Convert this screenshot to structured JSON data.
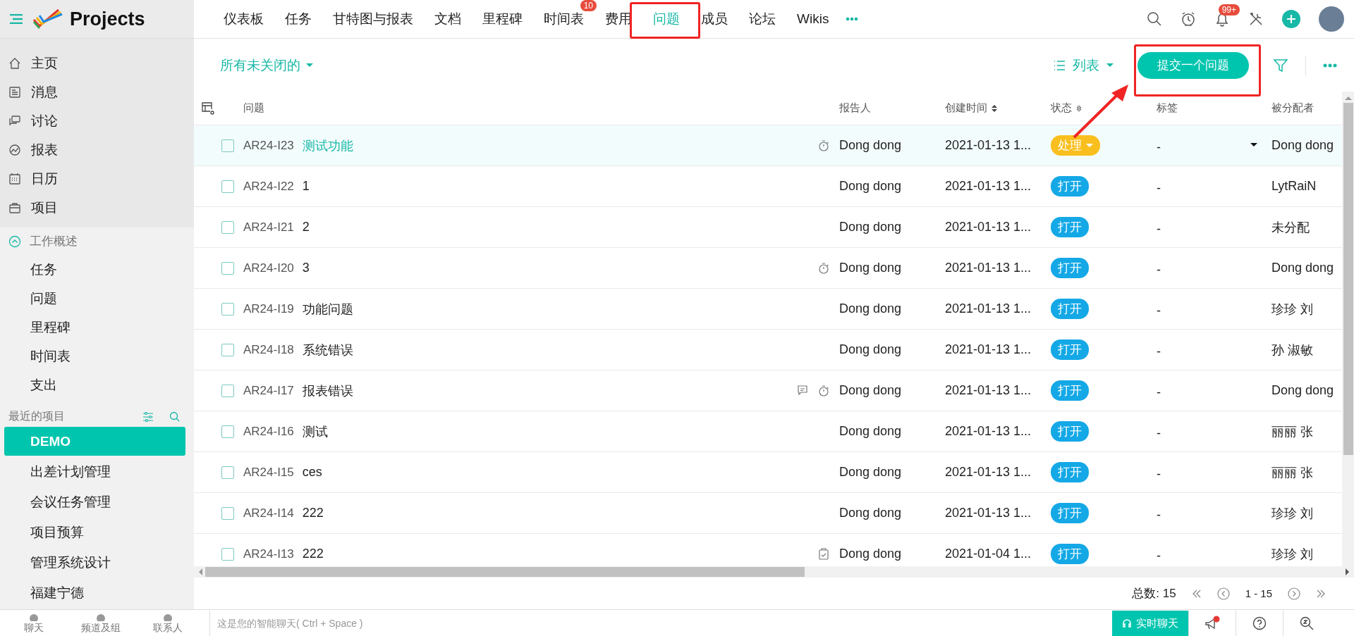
{
  "app": {
    "name": "Projects"
  },
  "sidebar": {
    "items": [
      "主页",
      "消息",
      "讨论",
      "报表",
      "日历",
      "项目"
    ],
    "overview": {
      "title": "工作概述",
      "expanded": true,
      "items": [
        "任务",
        "问题",
        "里程碑",
        "时间表",
        "支出"
      ]
    },
    "recent": {
      "title": "最近的项目",
      "projects": [
        {
          "label": "DEMO",
          "selected": true
        },
        {
          "label": "出差计划管理",
          "selected": false
        },
        {
          "label": "会议任务管理",
          "selected": false
        },
        {
          "label": "项目预算",
          "selected": false
        },
        {
          "label": "管理系统设计",
          "selected": false
        },
        {
          "label": "福建宁德",
          "selected": false
        }
      ]
    }
  },
  "tabs": [
    {
      "label": "仪表板",
      "selected": false
    },
    {
      "label": "任务",
      "selected": false
    },
    {
      "label": "甘特图与报表",
      "selected": false
    },
    {
      "label": "文档",
      "selected": false
    },
    {
      "label": "里程碑",
      "selected": false
    },
    {
      "label": "时间表",
      "selected": false,
      "badge": "10"
    },
    {
      "label": "费用",
      "selected": false
    },
    {
      "label": "问题",
      "selected": true
    },
    {
      "label": "成员",
      "selected": false
    },
    {
      "label": "论坛",
      "selected": false
    },
    {
      "label": "Wikis",
      "selected": false
    }
  ],
  "notifications_badge": "99+",
  "toolbar": {
    "filter_view": "所有未关闭的",
    "layout": "列表",
    "submit_button": "提交一个问题"
  },
  "table": {
    "columns": [
      "问题",
      "报告人",
      "创建时间",
      "状态",
      "标签",
      "被分配者"
    ],
    "rows": [
      {
        "id": "AR24-I23",
        "title": "测试功能",
        "selected": true,
        "comment": false,
        "timer": true,
        "checklist": false,
        "reporter": "Dong dong",
        "created": "2021-01-13 1...",
        "status": {
          "label": "处理",
          "color": "#f9bf1e",
          "dropdown": true
        },
        "tag": "-",
        "assignee": "Dong dong"
      },
      {
        "id": "AR24-I22",
        "title": "1",
        "selected": false,
        "comment": false,
        "timer": false,
        "checklist": false,
        "reporter": "Dong dong",
        "created": "2021-01-13 1...",
        "status": {
          "label": "打开",
          "color": "#14a8e6",
          "dropdown": false
        },
        "tag": "-",
        "assignee": "LytRaiN"
      },
      {
        "id": "AR24-I21",
        "title": "2",
        "selected": false,
        "comment": false,
        "timer": false,
        "checklist": false,
        "reporter": "Dong dong",
        "created": "2021-01-13 1...",
        "status": {
          "label": "打开",
          "color": "#14a8e6",
          "dropdown": false
        },
        "tag": "-",
        "assignee": "未分配"
      },
      {
        "id": "AR24-I20",
        "title": "3",
        "selected": false,
        "comment": false,
        "timer": true,
        "checklist": false,
        "reporter": "Dong dong",
        "created": "2021-01-13 1...",
        "status": {
          "label": "打开",
          "color": "#14a8e6",
          "dropdown": false
        },
        "tag": "-",
        "assignee": "Dong dong"
      },
      {
        "id": "AR24-I19",
        "title": "功能问题",
        "selected": false,
        "comment": false,
        "timer": false,
        "checklist": false,
        "reporter": "Dong dong",
        "created": "2021-01-13 1...",
        "status": {
          "label": "打开",
          "color": "#14a8e6",
          "dropdown": false
        },
        "tag": "-",
        "assignee": "珍珍 刘"
      },
      {
        "id": "AR24-I18",
        "title": "系统错误",
        "selected": false,
        "comment": false,
        "timer": false,
        "checklist": false,
        "reporter": "Dong dong",
        "created": "2021-01-13 1...",
        "status": {
          "label": "打开",
          "color": "#14a8e6",
          "dropdown": false
        },
        "tag": "-",
        "assignee": "孙 淑敏"
      },
      {
        "id": "AR24-I17",
        "title": "报表错误",
        "selected": false,
        "comment": true,
        "timer": true,
        "checklist": false,
        "reporter": "Dong dong",
        "created": "2021-01-13 1...",
        "status": {
          "label": "打开",
          "color": "#14a8e6",
          "dropdown": false
        },
        "tag": "-",
        "assignee": "Dong dong"
      },
      {
        "id": "AR24-I16",
        "title": "测试",
        "selected": false,
        "comment": false,
        "timer": false,
        "checklist": false,
        "reporter": "Dong dong",
        "created": "2021-01-13 1...",
        "status": {
          "label": "打开",
          "color": "#14a8e6",
          "dropdown": false
        },
        "tag": "-",
        "assignee": "丽丽 张"
      },
      {
        "id": "AR24-I15",
        "title": "ces",
        "selected": false,
        "comment": false,
        "timer": false,
        "checklist": false,
        "reporter": "Dong dong",
        "created": "2021-01-13 1...",
        "status": {
          "label": "打开",
          "color": "#14a8e6",
          "dropdown": false
        },
        "tag": "-",
        "assignee": "丽丽 张"
      },
      {
        "id": "AR24-I14",
        "title": "222",
        "selected": false,
        "comment": false,
        "timer": false,
        "checklist": false,
        "reporter": "Dong dong",
        "created": "2021-01-13 1...",
        "status": {
          "label": "打开",
          "color": "#14a8e6",
          "dropdown": false
        },
        "tag": "-",
        "assignee": "珍珍 刘"
      },
      {
        "id": "AR24-I13",
        "title": "222",
        "selected": false,
        "comment": false,
        "timer": false,
        "checklist": true,
        "reporter": "Dong dong",
        "created": "2021-01-04 1...",
        "status": {
          "label": "打开",
          "color": "#14a8e6",
          "dropdown": false
        },
        "tag": "-",
        "assignee": "珍珍 刘"
      }
    ]
  },
  "pagination": {
    "total": "总数: 15",
    "range": "1 - 15"
  },
  "chatbar": {
    "tabs": [
      "聊天",
      "频道及组",
      "联系人"
    ],
    "placeholder": "这是您的智能聊天( Ctrl + Space )",
    "live_chat": "实时聊天"
  }
}
